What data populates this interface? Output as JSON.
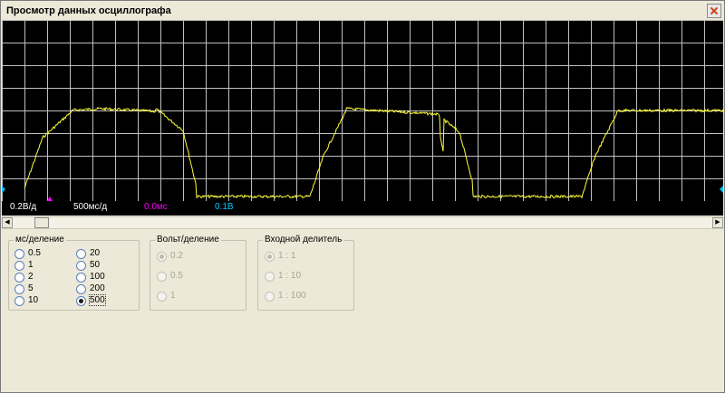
{
  "window": {
    "title": "Просмотр данных осциллографа"
  },
  "scope": {
    "grid_color": "#bfbfbf",
    "trace_color": "#ffff3c",
    "marker_color": "#00c8ff",
    "trigger_color": "#ff00ff"
  },
  "status": {
    "volts_div": "0.2В/д",
    "time_div": "500мс/д",
    "offset": "0.0мс",
    "level": "0.1В"
  },
  "scrollbar": {
    "left_arrow": "◀",
    "right_arrow": "▶"
  },
  "groups": {
    "ms_per_div": {
      "label": "мс/деление",
      "options": [
        "0.5",
        "1",
        "2",
        "5",
        "10",
        "20",
        "50",
        "100",
        "200",
        "500"
      ],
      "selected": "500"
    },
    "volt_per_div": {
      "label": "Вольт/деление",
      "options": [
        "0.2",
        "0.5",
        "1"
      ],
      "selected": "0.2"
    },
    "input_divider": {
      "label": "Входной делитель",
      "options": [
        "1 : 1",
        "1 : 10",
        "1 : 100"
      ],
      "selected": "1 : 1"
    }
  }
}
